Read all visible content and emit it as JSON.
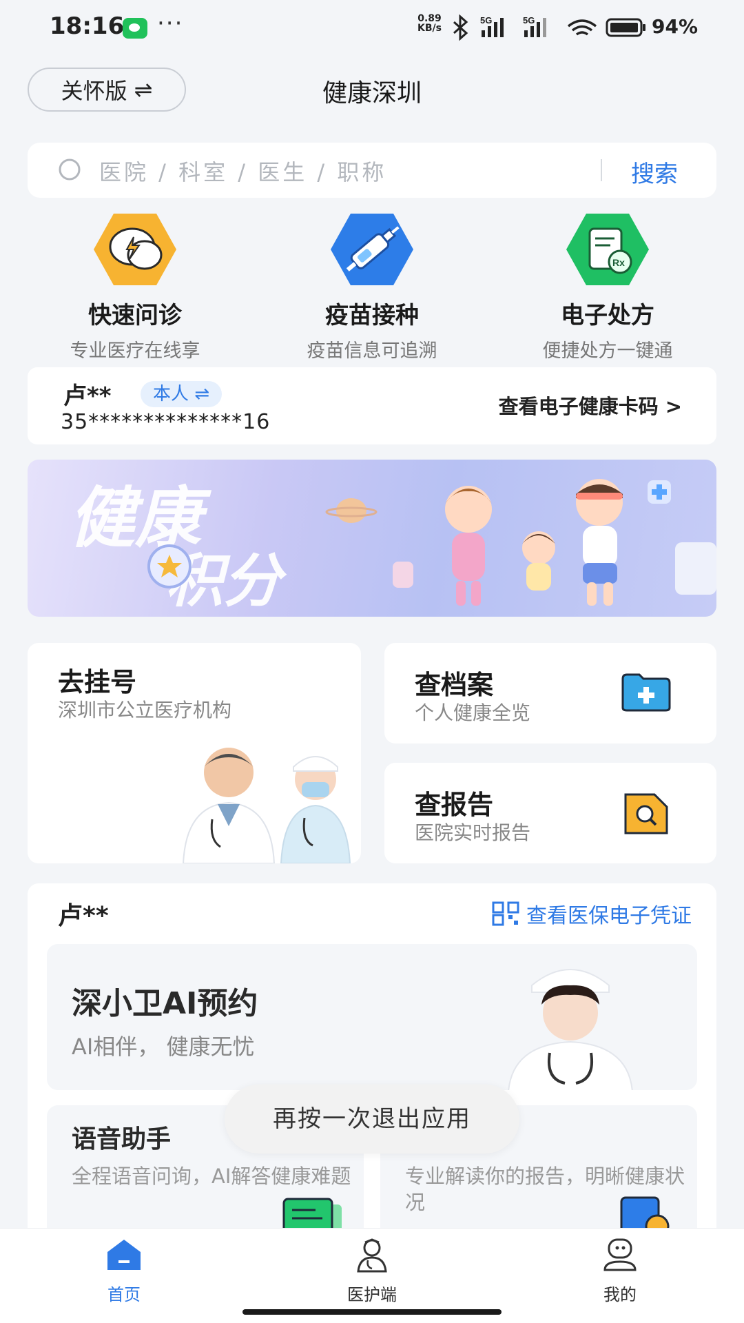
{
  "status_bar": {
    "time": "18:16",
    "dots": "···",
    "net_speed_value": "0.89",
    "net_speed_unit": "KB/s",
    "signal_1": "5G",
    "signal_2": "5G",
    "battery": "94%"
  },
  "header": {
    "care_mode_label": "关怀版",
    "switch_icon": "⇌",
    "title": "健康深圳"
  },
  "search": {
    "placeholder": "医院 / 科室 / 医生 / 职称",
    "button": "搜索"
  },
  "services": [
    {
      "title": "快速问诊",
      "subtitle": "专业医疗在线享",
      "icon": "chat-bolt-icon",
      "color": "#f7b331"
    },
    {
      "title": "疫苗接种",
      "subtitle": "疫苗信息可追溯",
      "icon": "syringe-icon",
      "color": "#2d7de8"
    },
    {
      "title": "电子处方",
      "subtitle": "便捷处方一键通",
      "icon": "prescription-icon",
      "color": "#1fbf63"
    }
  ],
  "health_card": {
    "name": "卢**",
    "relation": "本人 ⇌",
    "id_number": "35**************16",
    "view_link": "查看电子健康卡码 >"
  },
  "banner": {
    "text_line1": "健康",
    "text_line2": "积分"
  },
  "cards": {
    "register": {
      "title": "去挂号",
      "subtitle": "深圳市公立医疗机构"
    },
    "archive": {
      "title": "查档案",
      "subtitle": "个人健康全览"
    },
    "report": {
      "title": "查报告",
      "subtitle": "医院实时报告"
    }
  },
  "insurance": {
    "name": "卢**",
    "link": "查看医保电子凭证",
    "ai": {
      "title": "深小卫AI预约",
      "subtitle": "AI相伴， 健康无忧"
    },
    "voice": {
      "title": "语音助手",
      "subtitle": "全程语音问询，AI解答健康难题"
    },
    "report_reader": {
      "subtitle": "专业解读你的报告，明晰健康状况"
    }
  },
  "toast": "再按一次退出应用",
  "nav": [
    {
      "label": "首页",
      "icon": "home-icon",
      "active": true
    },
    {
      "label": "医护端",
      "icon": "nurse-icon",
      "active": false
    },
    {
      "label": "我的",
      "icon": "profile-icon",
      "active": false
    }
  ],
  "colors": {
    "accent": "#2f7ae5",
    "background": "#f3f5f8"
  }
}
